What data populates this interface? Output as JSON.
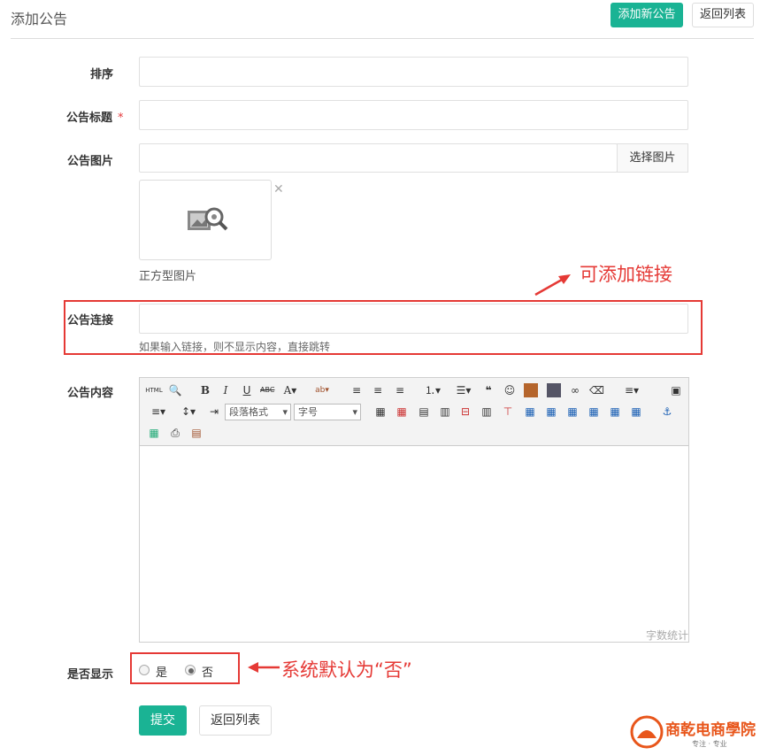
{
  "header": {
    "title": "添加公告",
    "add_button": "添加新公告",
    "back_button": "返回列表"
  },
  "form": {
    "sort_label": "排序",
    "title_label": "公告标题",
    "required_mark": "*",
    "image_label": "公告图片",
    "choose_image_button": "选择图片",
    "image_caption": "正方型图片",
    "link_label": "公告连接",
    "link_hint": "如果输入链接，则不显示内容，直接跳转",
    "content_label": "公告内容",
    "display_label": "是否显示",
    "display_options": [
      "是",
      "否"
    ],
    "display_selected": "否",
    "submit_button": "提交",
    "back_button": "返回列表"
  },
  "editor": {
    "paragraph_select": "段落格式",
    "fontsize_select": "字号",
    "word_count": "字数统计",
    "toolbar_row1": [
      "HTML",
      "B",
      "I",
      "U",
      "ABC",
      "A",
      "❝"
    ],
    "colors": {
      "toolbar_bg": "#f3f3f3"
    }
  },
  "annotations": {
    "link_note": "可添加链接",
    "display_note": "系统默认为“否”"
  },
  "watermark": {
    "text": "商乾电商學院",
    "sub": "专注 · 专业"
  },
  "colors": {
    "accent": "#1ab394",
    "annotation_red": "#e53935",
    "required": "#e4393c"
  }
}
